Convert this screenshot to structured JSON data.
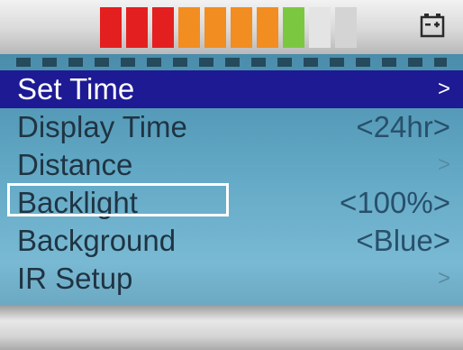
{
  "status_bar": {
    "level_segments": [
      "#e41f1f",
      "#e41f1f",
      "#e41f1f",
      "#f28d21",
      "#f28d21",
      "#f28d21",
      "#f28d21",
      "#7bc840",
      "#e4e4e4",
      "#d4d4d4"
    ],
    "battery_icon": "battery-charging-icon"
  },
  "menu": {
    "items": [
      {
        "label": "Set Time",
        "value": ">"
      },
      {
        "label": "Display Time",
        "value": "<24hr>"
      },
      {
        "label": "Distance",
        "value": ">"
      },
      {
        "label": "Backlight",
        "value": "<100%>"
      },
      {
        "label": "Background",
        "value": "<Blue>"
      },
      {
        "label": "IR Setup",
        "value": ">"
      }
    ],
    "selected_index": 0,
    "focused_index": 3
  },
  "colors": {
    "selected_row": "#1d1a94",
    "focus_outline": "#ffffff"
  }
}
